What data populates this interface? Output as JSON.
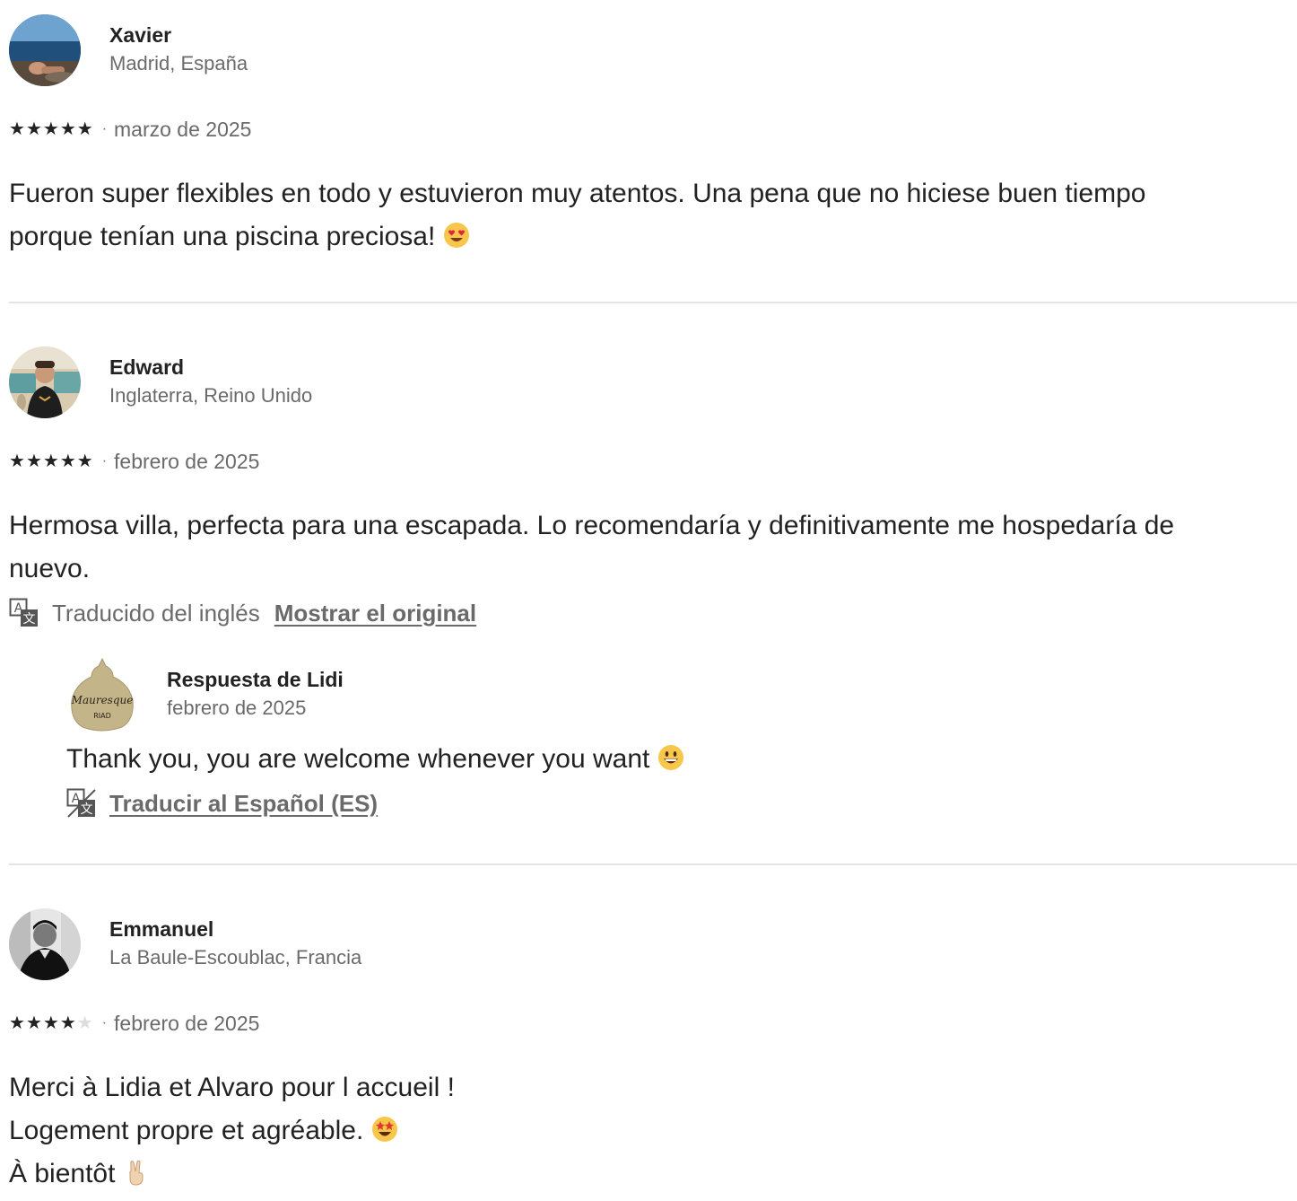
{
  "reviews": [
    {
      "name": "Xavier",
      "location": "Madrid, España",
      "rating": 5,
      "date": "marzo de 2025",
      "text_lines": [
        "Fueron super flexibles en todo y estuvieron muy atentos. Una pena que no hiciese buen tiempo",
        "porque tenían una piscina preciosa!"
      ],
      "emoji": "heart-eyes-emoji"
    },
    {
      "name": "Edward",
      "location": "Inglaterra, Reino Unido",
      "rating": 5,
      "date": "febrero de 2025",
      "text_lines": [
        "Hermosa villa, perfecta para una escapada. Lo recomendaría y definitivamente me hospedaría de",
        "nuevo."
      ],
      "translated_note": "Traducido del inglés",
      "show_original_label": "Mostrar el original",
      "response": {
        "title": "Respuesta de Lidi",
        "date": "febrero de 2025",
        "text": "Thank you, you are welcome whenever you want",
        "emoji": "grinning-face-emoji",
        "translate_label": "Traducir al Español (ES)",
        "logo_text": "Mauresque",
        "logo_subtext": "RIAD"
      }
    },
    {
      "name": "Emmanuel",
      "location": "La Baule-Escoublac, Francia",
      "rating": 4,
      "date": "febrero de 2025",
      "text_lines": [
        "Merci à Lidia et Alvaro pour l accueil !",
        "Logement propre et agréable.",
        "À bientôt"
      ],
      "emojis": [
        "star-struck-emoji",
        "victory-hand-emoji"
      ]
    }
  ],
  "star_glyph": "★",
  "separator": "·",
  "colors": {
    "primary_text": "#222222",
    "secondary_text": "#6a6a6a",
    "divider": "#e3e3e3",
    "empty_star": "#dddddd"
  }
}
